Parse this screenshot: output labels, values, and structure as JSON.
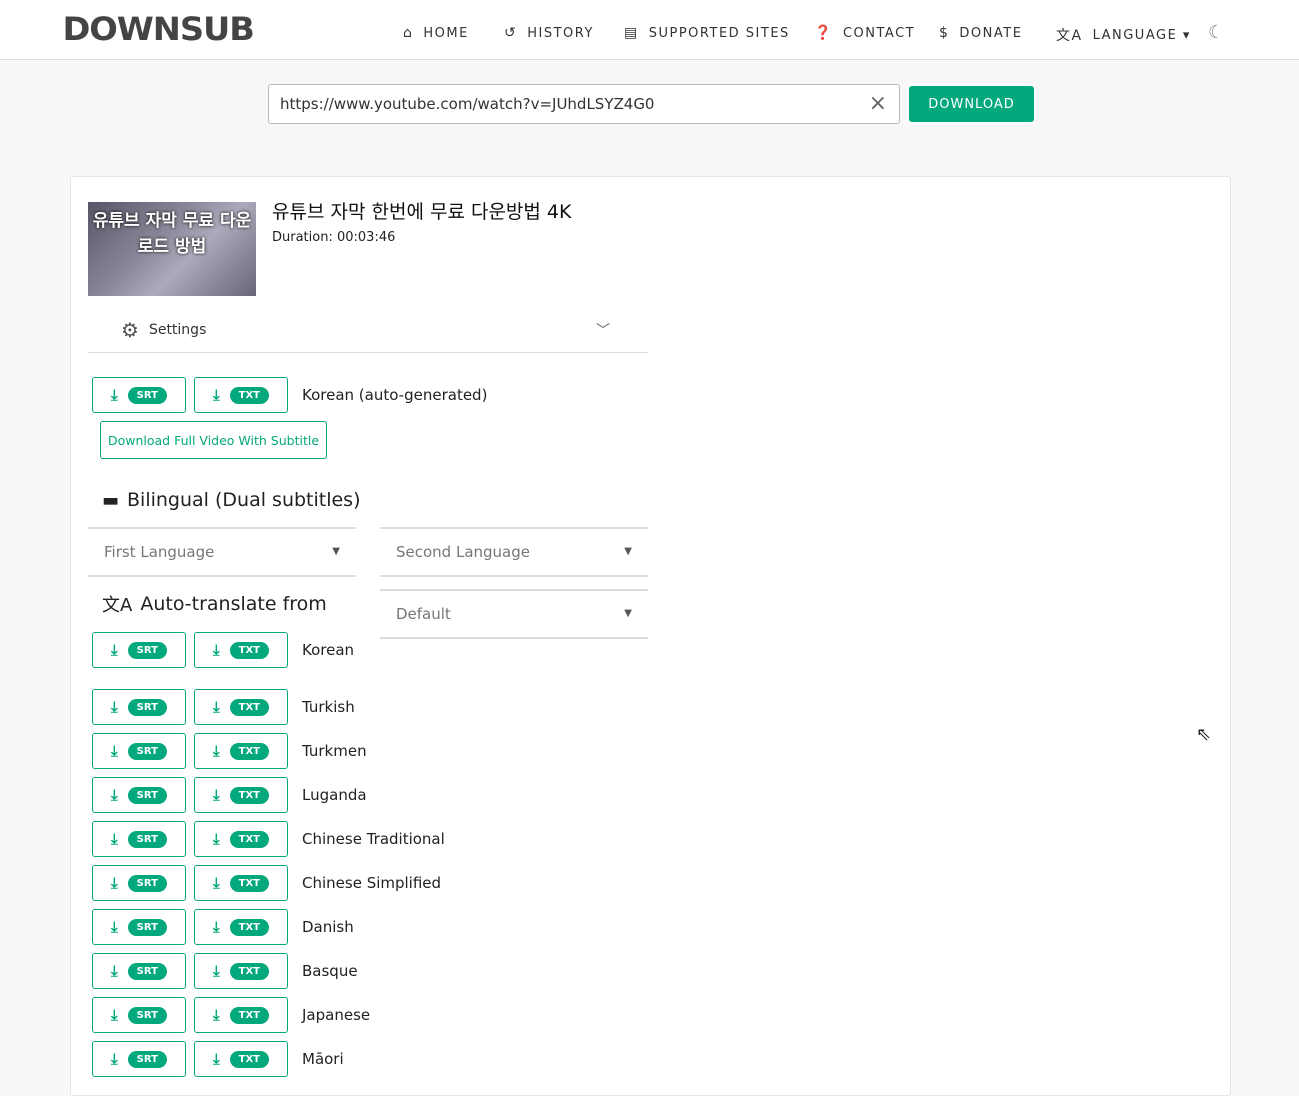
{
  "header": {
    "logo": "DOWNSUB",
    "nav": [
      {
        "icon": "home-icon",
        "glyph": "⌂",
        "label": "HOME"
      },
      {
        "icon": "history-icon",
        "glyph": "↺",
        "label": "HISTORY"
      },
      {
        "icon": "list-icon",
        "glyph": "▤",
        "label": "SUPPORTED SITES"
      },
      {
        "icon": "question-icon",
        "glyph": "❓",
        "label": "CONTACT"
      },
      {
        "icon": "dollar-icon",
        "glyph": "$",
        "label": "DONATE"
      },
      {
        "icon": "translate-icon",
        "glyph": "文A",
        "label": "LANGUAGE ▾"
      }
    ],
    "theme_icon": "theme-toggle-icon"
  },
  "search": {
    "value": "https://www.youtube.com/watch?v=JUhdLSYZ4G0",
    "download_label": "DOWNLOAD"
  },
  "video": {
    "thumb_text": "유튜브 자막 무료 다운로드 방법",
    "title": "유튜브 자막 한번에 무료 다운방법 4K",
    "duration": "Duration: 00:03:46"
  },
  "settings_label": "Settings",
  "formats": {
    "srt": "SRT",
    "txt": "TXT"
  },
  "original": {
    "language": "Korean (auto-generated)",
    "full_video_label": "Download Full Video With Subtitle"
  },
  "bilingual": {
    "heading": "Bilingual (Dual subtitles)",
    "first_placeholder": "First Language",
    "second_placeholder": "Second Language",
    "default_label": "Default"
  },
  "auto_translate": {
    "heading": "Auto-translate from",
    "source": "Korean",
    "languages": [
      "Turkish",
      "Turkmen",
      "Luganda",
      "Chinese Traditional",
      "Chinese Simplified",
      "Danish",
      "Basque",
      "Japanese",
      "Māori"
    ]
  },
  "colors": {
    "accent": "#03a87c"
  }
}
